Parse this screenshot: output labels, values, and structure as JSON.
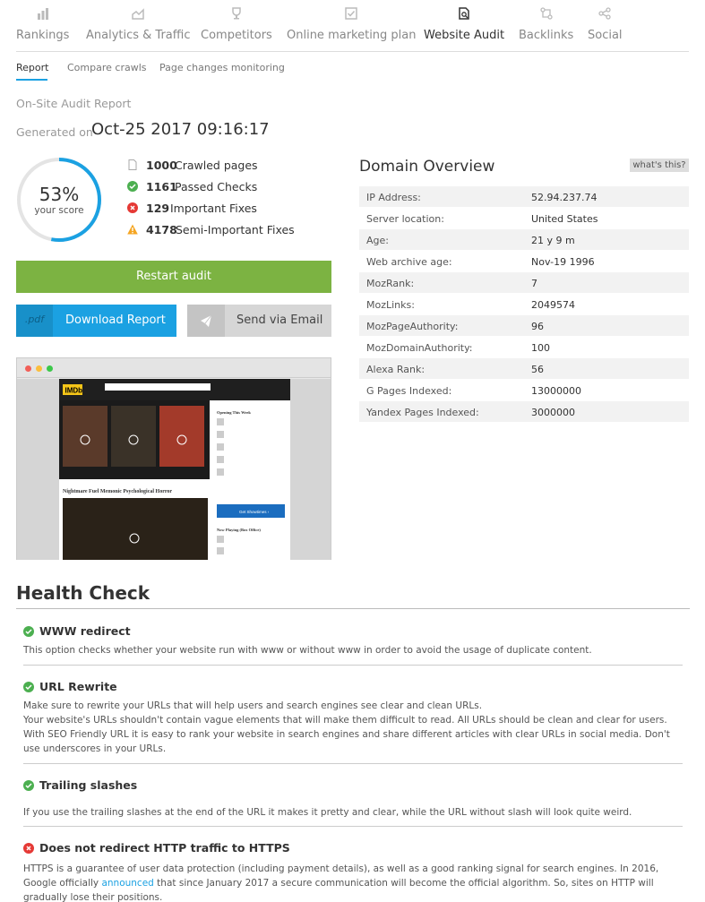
{
  "nav": {
    "items": [
      {
        "label": "Rankings",
        "icon": "bar-chart-icon"
      },
      {
        "label": "Analytics & Traffic",
        "icon": "area-chart-icon"
      },
      {
        "label": "Competitors",
        "icon": "trophy-icon"
      },
      {
        "label": "Online marketing plan",
        "icon": "checkbox-icon"
      },
      {
        "label": "Website Audit",
        "icon": "audit-document-icon"
      },
      {
        "label": "Backlinks",
        "icon": "backlinks-icon"
      },
      {
        "label": "Social",
        "icon": "share-icon"
      }
    ],
    "active": "Website Audit"
  },
  "subnav": {
    "items": [
      "Report",
      "Compare crawls",
      "Page changes monitoring"
    ],
    "active": "Report"
  },
  "report": {
    "title": "On-Site Audit Report",
    "generated_label": "Generated on",
    "generated_date": "Oct-25 2017 09:16:17"
  },
  "score": {
    "percent_text": "53%",
    "percent_value": 53,
    "label": "your score",
    "ring_color": "#1ba1e2"
  },
  "stats": [
    {
      "value": "1000",
      "label": "Crawled pages",
      "icon": "page-icon"
    },
    {
      "value": "1161",
      "label": "Passed Checks",
      "icon": "check-circle-icon"
    },
    {
      "value": "129",
      "label": "Important Fixes",
      "icon": "error-circle-icon"
    },
    {
      "value": "4178",
      "label": "Semi-Important Fixes",
      "icon": "warning-icon"
    }
  ],
  "buttons": {
    "restart": "Restart audit",
    "download_badge": ".pdf",
    "download": "Download Report",
    "email": "Send via Email"
  },
  "preview": {
    "site_logo": "IMDb",
    "heading": "Nightmare Fuel Memonic Psychological Horror",
    "sidebar_title": "Opening This Week",
    "cta": "Get Showtimes ›",
    "sidebar_title_2": "Now Playing (Box Office)"
  },
  "domain": {
    "title": "Domain Overview",
    "whats_this": "what's this?",
    "rows": [
      {
        "key": "IP Address:",
        "value": "52.94.237.74"
      },
      {
        "key": "Server location:",
        "value": "United States"
      },
      {
        "key": "Age:",
        "value": "21 y 9 m"
      },
      {
        "key": "Web archive age:",
        "value": "Nov-19 1996"
      },
      {
        "key": "MozRank:",
        "value": "7"
      },
      {
        "key": "MozLinks:",
        "value": "2049574"
      },
      {
        "key": "MozPageAuthority:",
        "value": "96"
      },
      {
        "key": "MozDomainAuthority:",
        "value": "100"
      },
      {
        "key": "Alexa Rank:",
        "value": "56"
      },
      {
        "key": "G Pages Indexed:",
        "value": "13000000"
      },
      {
        "key": "Yandex Pages Indexed:",
        "value": "3000000"
      }
    ]
  },
  "health": {
    "title": "Health Check",
    "items": [
      {
        "status": "pass",
        "title": "WWW redirect",
        "text": "This option checks whether your website run with www or without www in order to avoid the usage of duplicate content."
      },
      {
        "status": "pass",
        "title": "URL Rewrite",
        "text1": "Make sure to rewrite your URLs that will help users and search engines see clear and clean URLs.",
        "text2": "Your website's URLs shouldn't contain vague elements that will make them difficult to read. All URLs should be clean and clear for users. With SEO Friendly URL it is easy to rank your website in search engines and share different articles with clear URLs in social media. Don't use underscores in your URLs."
      },
      {
        "status": "pass",
        "title": "Trailing slashes",
        "text": "If you use the trailing slashes at the end of the URL it makes it pretty and clear, while the URL without slash will look quite weird."
      },
      {
        "status": "fail",
        "title": "Does not redirect HTTP traffic to HTTPS",
        "text_before": "HTTPS is a guarantee of user data protection (including payment details), as well as a good ranking signal for search engines. In 2016, Google officially ",
        "link": "announced",
        "text_after": " that since January 2017 a secure communication will become the official algorithm. So, sites on HTTP will gradually lose their positions."
      }
    ]
  }
}
